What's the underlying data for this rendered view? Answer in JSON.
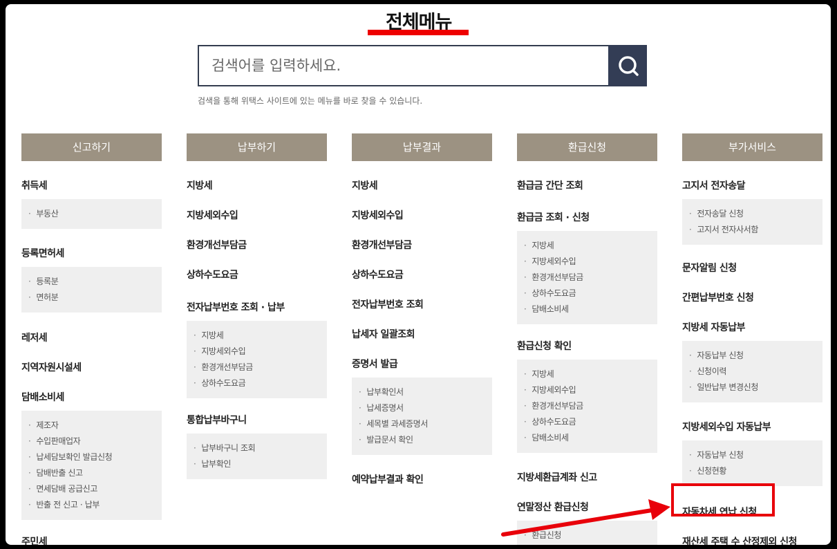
{
  "title": "전체메뉴",
  "search": {
    "placeholder": "검색어를 입력하세요.",
    "hint": "검색을 통해 위택스 사이트에 있는 메뉴를 바로 찾을 수 있습니다."
  },
  "columns": [
    {
      "header": "신고하기",
      "groups": [
        {
          "label": "취득세",
          "subs": [
            "부동산"
          ]
        },
        {
          "label": "등록면허세",
          "subs": [
            "등록분",
            "면허분"
          ]
        },
        {
          "label": "레저세",
          "subs": []
        },
        {
          "label": "지역자원시설세",
          "subs": []
        },
        {
          "label": "담배소비세",
          "subs": [
            "제조자",
            "수입판매업자",
            "납세담보확인 발급신청",
            "담배반출 신고",
            "면세담배 공급신고",
            "반출 전 신고 · 납부"
          ]
        },
        {
          "label": "주민세",
          "subs": []
        }
      ]
    },
    {
      "header": "납부하기",
      "groups": [
        {
          "label": "지방세",
          "subs": []
        },
        {
          "label": "지방세외수입",
          "subs": []
        },
        {
          "label": "환경개선부담금",
          "subs": []
        },
        {
          "label": "상하수도요금",
          "subs": []
        },
        {
          "label": "전자납부번호 조회 · 납부",
          "subs": [
            "지방세",
            "지방세외수입",
            "환경개선부담금",
            "상하수도요금"
          ]
        },
        {
          "label": "통합납부바구니",
          "subs": [
            "납부바구니 조회",
            "납부확인"
          ]
        }
      ]
    },
    {
      "header": "납부결과",
      "groups": [
        {
          "label": "지방세",
          "subs": []
        },
        {
          "label": "지방세외수입",
          "subs": []
        },
        {
          "label": "환경개선부담금",
          "subs": []
        },
        {
          "label": "상하수도요금",
          "subs": []
        },
        {
          "label": "전자납부번호 조회",
          "subs": []
        },
        {
          "label": "납세자 일괄조회",
          "subs": []
        },
        {
          "label": "증명서 발급",
          "subs": [
            "납부확인서",
            "납세증명서",
            "세목별 과세증명서",
            "발급문서 확인"
          ]
        },
        {
          "label": "예약납부결과 확인",
          "subs": []
        }
      ]
    },
    {
      "header": "환급신청",
      "groups": [
        {
          "label": "환급금 간단 조회",
          "subs": []
        },
        {
          "label": "환급금 조회 · 신청",
          "subs": [
            "지방세",
            "지방세외수입",
            "환경개선부담금",
            "상하수도요금",
            "담배소비세"
          ]
        },
        {
          "label": "환급신청 확인",
          "subs": [
            "지방세",
            "지방세외수입",
            "환경개선부담금",
            "상하수도요금",
            "담배소비세"
          ]
        },
        {
          "label": "지방세환급계좌 신고",
          "subs": []
        },
        {
          "label": "연말정산 환급신청",
          "subs": [
            "환급신청"
          ]
        }
      ]
    },
    {
      "header": "부가서비스",
      "groups": [
        {
          "label": "고지서 전자송달",
          "subs": [
            "전자송달 신청",
            "고지서 전자사서함"
          ]
        },
        {
          "label": "문자알림 신청",
          "subs": []
        },
        {
          "label": "간편납부번호 신청",
          "subs": []
        },
        {
          "label": "지방세 자동납부",
          "subs": [
            "자동납부 신청",
            "신청이력",
            "일반납부 변경신청"
          ]
        },
        {
          "label": "지방세외수입 자동납부",
          "subs": [
            "자동납부 신청",
            "신청현황"
          ]
        },
        {
          "label": "자동차세 연납 신청",
          "subs": []
        },
        {
          "label": "재산세 주택 수 산정제외 신청",
          "subs": []
        }
      ]
    }
  ],
  "annotation": {
    "color": "#e8000a",
    "highlighted_item": "자동차세 연납 신청"
  }
}
